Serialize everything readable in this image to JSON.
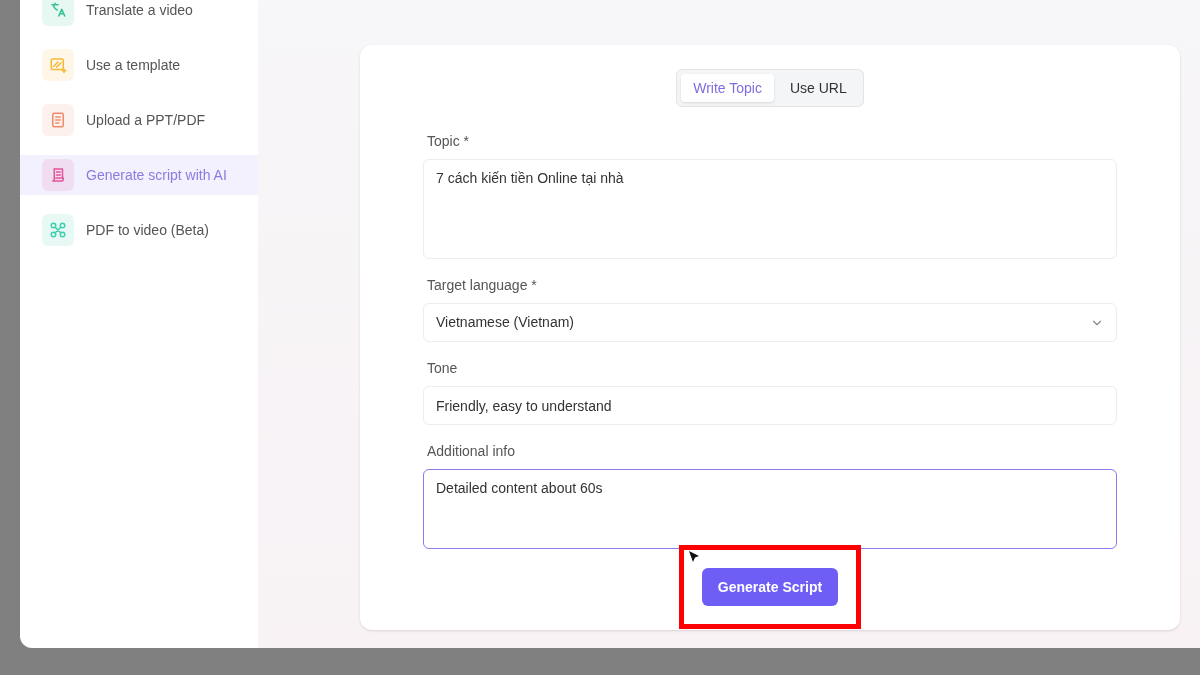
{
  "sidebar": {
    "items": [
      {
        "label": "Translate a video",
        "selected": false
      },
      {
        "label": "Use a template",
        "selected": false
      },
      {
        "label": "Upload a PPT/PDF",
        "selected": false
      },
      {
        "label": "Generate script with AI",
        "selected": true
      },
      {
        "label": "PDF to video (Beta)",
        "selected": false
      }
    ]
  },
  "tabs": [
    {
      "label": "Write Topic",
      "selected": true
    },
    {
      "label": "Use URL",
      "selected": false
    }
  ],
  "form": {
    "fields": [
      {
        "kind": "textarea",
        "label": "Topic *",
        "value": "7 cách kiến tiền Online tại nhà",
        "focused": false
      },
      {
        "kind": "select",
        "label": "Target language *",
        "value": "Vietnamese (Vietnam)",
        "focused": false
      },
      {
        "kind": "input",
        "label": "Tone",
        "value": "Friendly, easy to understand",
        "focused": false
      },
      {
        "kind": "textarea",
        "label": "Additional info",
        "value": "Detailed content about 60s",
        "focused": true
      }
    ]
  },
  "submit": {
    "label": "Generate Script",
    "highlighted": true
  }
}
